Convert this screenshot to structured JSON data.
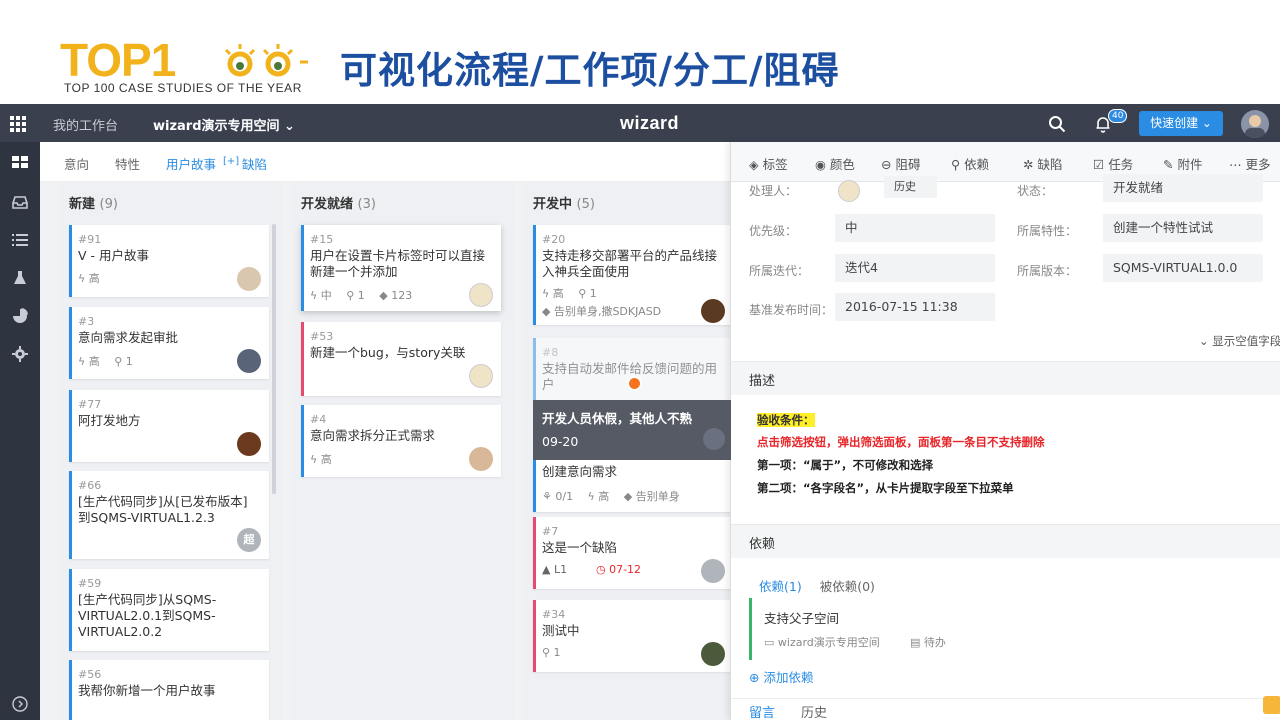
{
  "banner": {
    "logo_text": "TOP1",
    "logo_sub": "TOP 100 CASE STUDIES OF THE YEAR",
    "title": "可视化流程/工作项/分工/阻碍"
  },
  "topbar": {
    "my_workspace": "我的工作台",
    "space_name": "wizard演示专用空间 ⌄",
    "brand": "wizard",
    "notif_count": "40",
    "quick_create": "快速创建 ⌄"
  },
  "filters": {
    "f1": "意向",
    "f2": "特性",
    "f3": "用户故事",
    "f4": "缺陷"
  },
  "columns": [
    {
      "name": "新建",
      "count": "(9)"
    },
    {
      "name": "开发就绪",
      "count": "(3)"
    },
    {
      "name": "开发中",
      "count": "(5)"
    }
  ],
  "cards": {
    "c91": {
      "num": "#91",
      "title": "V - 用户故事",
      "meta": "ϟ 高"
    },
    "c3": {
      "num": "#3",
      "title": "意向需求发起审批",
      "meta": "ϟ 高　 ⚲ 1"
    },
    "c77": {
      "num": "#77",
      "title": "阿打发地方"
    },
    "c66": {
      "num": "#66",
      "title": "[生产代码同步]从[已发布版本]到SQMS-VIRTUAL1.2.3",
      "avatar_text": "超"
    },
    "c59": {
      "num": "#59",
      "title": "[生产代码同步]从SQMS-VIRTUAL2.0.1到SQMS-VIRTUAL2.0.2"
    },
    "c56": {
      "num": "#56",
      "title": "我帮你新增一个用户故事"
    },
    "c15": {
      "num": "#15",
      "title": "用户在设置卡片标签时可以直接新建一个并添加",
      "meta": "ϟ 中　 ⚲ 1　 ◆ 123"
    },
    "c53": {
      "num": "#53",
      "title": "新建一个bug，与story关联"
    },
    "c4": {
      "num": "#4",
      "title": "意向需求拆分正式需求",
      "meta": "ϟ 高"
    },
    "c20": {
      "num": "#20",
      "title": "支持走移交部署平台的产品线接入神兵全面使用",
      "meta": "ϟ 高　 ⚲ 1",
      "meta2": "◆ 告别单身,撒SDKJASD"
    },
    "c8": {
      "num": "#8",
      "title": "支持自动发邮件给反馈问题的用户"
    },
    "c2": {
      "num": "#2",
      "title": "创建意向需求",
      "meta": "⚘ 0/1　 ϟ 高　 ◆ 告别单身"
    },
    "c7": {
      "num": "#7",
      "title": "这是一个缺陷",
      "meta_level": "▲ L1",
      "meta_date": "◷ 07-12"
    },
    "c34": {
      "num": "#34",
      "title": "测试中",
      "meta": "⚲ 1"
    }
  },
  "tooltip": {
    "text": "开发人员休假，其他人不熟",
    "date": "09-20"
  },
  "panel": {
    "toolbar": [
      "标签",
      "颜色",
      "阻碍",
      "依赖",
      "缺陷",
      "任务",
      "附件",
      "更多"
    ],
    "owner_label": "处理人：",
    "history_btn": "历史",
    "status_label": "状态：",
    "status_value": "开发就绪",
    "priority_label": "优先级：",
    "priority_value": "中",
    "feature_label": "所属特性：",
    "feature_value": "创建一个特性试试",
    "iteration_label": "所属迭代：",
    "iteration_value": "迭代4",
    "version_label": "所属版本：",
    "version_value": "SQMS-VIRTUAL1.0.0",
    "release_label": "基准发布时间：",
    "release_value": "2016-07-15 11:38",
    "show_empty": "⌄ 显示空值字段",
    "desc_title": "描述",
    "desc_line1": "验收条件：",
    "desc_line2": "点击筛选按钮，弹出筛选面板，面板第一条目不支持删除",
    "desc_line3": "第一项：“属于”，不可修改和选择",
    "desc_line4": "第二项：“各字段名”，从卡片提取字段至下拉菜单",
    "dep_title": "依赖",
    "dep_tab1": "依赖(1)",
    "dep_tab2": "被依赖(0)",
    "dep_item_title": "支持父子空间",
    "dep_item_space": "wizard演示专用空间",
    "dep_item_status": "待办",
    "add_dep": "添加依赖",
    "footer_tab1": "留言",
    "footer_tab2": "历史"
  },
  "colors": {
    "accent": "#2a8de3",
    "topbar": "#3a404e",
    "sidenav": "#2f3441",
    "bug": "#e64b6f",
    "title_blue": "#1c4fa0",
    "logo_gold": "#f2b21c"
  }
}
